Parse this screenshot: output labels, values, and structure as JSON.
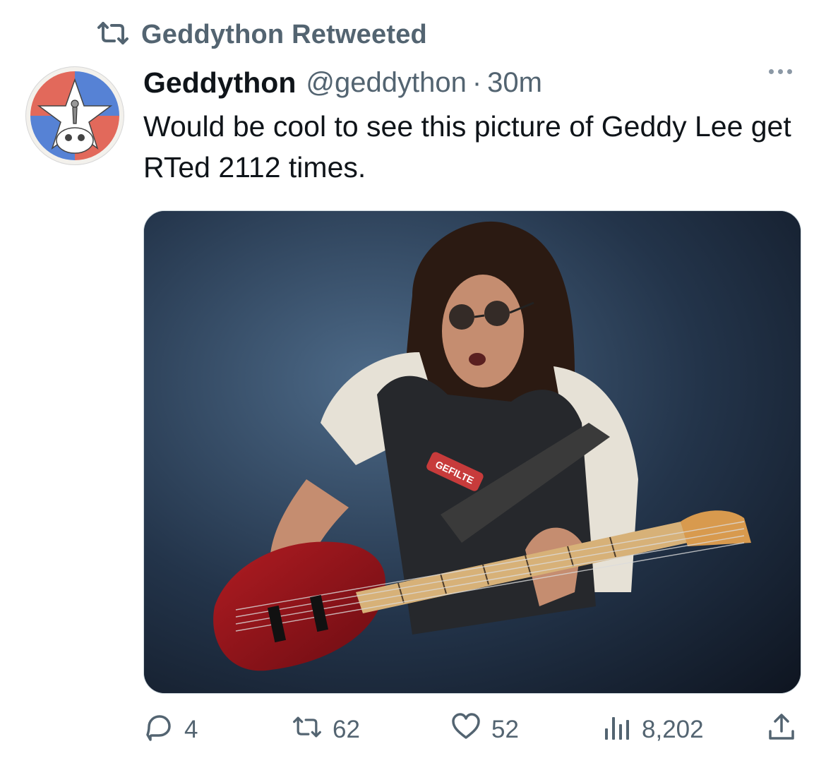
{
  "retweet": {
    "label": "Geddython Retweeted",
    "icon": "retweet-icon"
  },
  "author": {
    "display_name": "Geddython",
    "handle": "@geddython",
    "separator": "·",
    "timestamp": "30m",
    "avatar": "avatar-star-skull-logo"
  },
  "tweet": {
    "text": "Would be cool to see this picture of Geddy Lee get RTed 2112 times.",
    "media": {
      "type": "photo",
      "subject": "man with long hair and round sunglasses playing a red bass guitar",
      "shirt_text": "GEFILTE"
    }
  },
  "actions": {
    "replies": "4",
    "retweets": "62",
    "likes": "52",
    "views": "8,202"
  },
  "colors": {
    "text": "#0f1419",
    "secondary": "#536471",
    "border": "#cfd9de"
  }
}
